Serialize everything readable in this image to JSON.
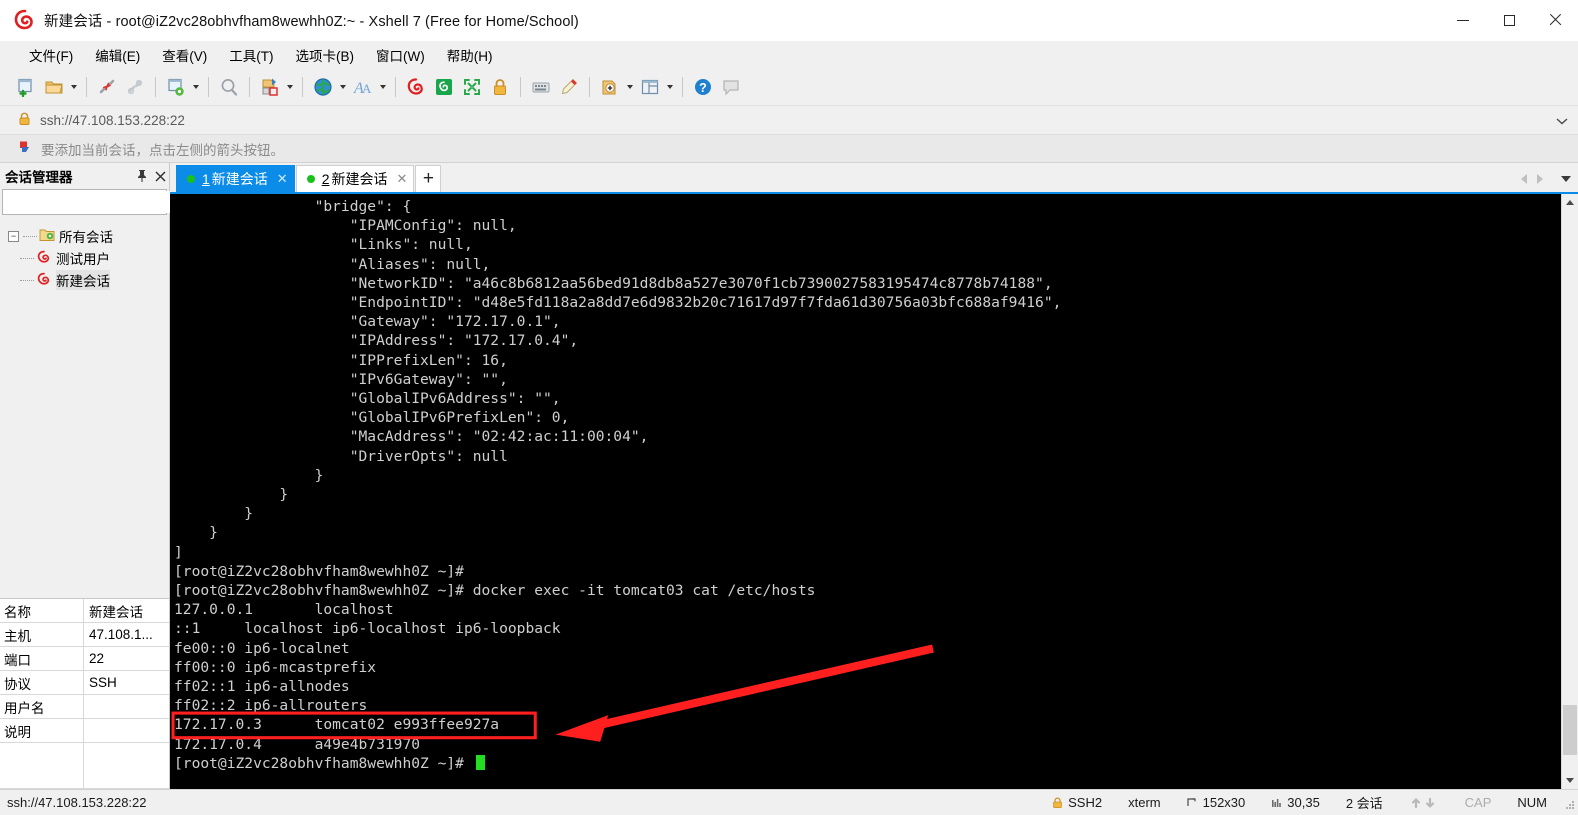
{
  "window": {
    "title": "新建会话 - root@iZ2vc28obhvfham8wewhh0Z:~ - Xshell 7 (Free for Home/School)",
    "minimize_label": "最小化",
    "maximize_label": "最大化",
    "close_label": "关闭"
  },
  "menubar": [
    {
      "label": "文件(F)",
      "name": "menu-file"
    },
    {
      "label": "编辑(E)",
      "name": "menu-edit"
    },
    {
      "label": "查看(V)",
      "name": "menu-view"
    },
    {
      "label": "工具(T)",
      "name": "menu-tools"
    },
    {
      "label": "选项卡(B)",
      "name": "menu-tab"
    },
    {
      "label": "窗口(W)",
      "name": "menu-window"
    },
    {
      "label": "帮助(H)",
      "name": "menu-help"
    }
  ],
  "toolbar": {
    "items": [
      "new-session-icon",
      "open-folder-icon",
      "disconnect-icon",
      "reconnect-icon",
      "session-properties-icon",
      "find-icon",
      "transfer-file-icon",
      "globe-icon",
      "font-icon",
      "xshell-icon",
      "xftp-icon",
      "fullscreen-icon",
      "lock-icon",
      "keyboard-icon",
      "highlight-icon",
      "compose-icon",
      "layout-icon",
      "help-icon",
      "comment-icon"
    ]
  },
  "address_bar": {
    "url": "ssh://47.108.153.228:22",
    "lock_icon": "lock-icon",
    "dropdown_icon": "chevron-down-icon"
  },
  "notice": {
    "text": "要添加当前会话，点击左侧的箭头按钮。",
    "icon": "arrow-flag-icon"
  },
  "sidebar": {
    "title": "会话管理器",
    "pin_label": "📌",
    "close_label": "✕",
    "search_placeholder": "",
    "search_value": "",
    "tree": [
      {
        "label": "所有会话",
        "level": 0,
        "icon": "folder-gear-icon",
        "selected": false
      },
      {
        "label": "测试用户",
        "level": 1,
        "icon": "session-icon",
        "selected": false
      },
      {
        "label": "新建会话",
        "level": 1,
        "icon": "session-icon",
        "selected": true
      }
    ],
    "properties": [
      {
        "key": "名称",
        "value": "新建会话"
      },
      {
        "key": "主机",
        "value": "47.108.1..."
      },
      {
        "key": "端口",
        "value": "22"
      },
      {
        "key": "协议",
        "value": "SSH"
      },
      {
        "key": "用户名",
        "value": ""
      },
      {
        "key": "说明",
        "value": ""
      }
    ]
  },
  "tabs": {
    "items": [
      {
        "num": "1",
        "label": "新建会话",
        "active": true,
        "close": "✕"
      },
      {
        "num": "2",
        "label": "新建会话",
        "active": false,
        "close": "✕"
      }
    ],
    "add_label": "+",
    "nav_prev_icon": "chevron-left-icon",
    "nav_next_icon": "chevron-right-icon",
    "nav_menu_icon": "chevron-down-icon"
  },
  "terminal": {
    "content": "                \"bridge\": {\n                    \"IPAMConfig\": null,\n                    \"Links\": null,\n                    \"Aliases\": null,\n                    \"NetworkID\": \"a46c8b6812aa56bed91d8db8a527e3070f1cb7390027583195474c8778b74188\",\n                    \"EndpointID\": \"d48e5fd118a2a8dd7e6d9832b20c71617d97f7fda61d30756a03bfc688af9416\",\n                    \"Gateway\": \"172.17.0.1\",\n                    \"IPAddress\": \"172.17.0.4\",\n                    \"IPPrefixLen\": 16,\n                    \"IPv6Gateway\": \"\",\n                    \"GlobalIPv6Address\": \"\",\n                    \"GlobalIPv6PrefixLen\": 0,\n                    \"MacAddress\": \"02:42:ac:11:00:04\",\n                    \"DriverOpts\": null\n                }\n            }\n        }\n    }\n]\n[root@iZ2vc28obhvfham8wewhh0Z ~]#\n[root@iZ2vc28obhvfham8wewhh0Z ~]# docker exec -it tomcat03 cat /etc/hosts\n127.0.0.1       localhost\n::1     localhost ip6-localhost ip6-loopback\nfe00::0 ip6-localnet\nff00::0 ip6-mcastprefix\nff02::1 ip6-allnodes\nff02::2 ip6-allrouters\n172.17.0.3      tomcat02 e993ffee927a\n172.17.0.4      a49e4b731970\n[root@iZ2vc28obhvfham8wewhh0Z ~]# ",
    "highlight_line": "172.17.0.3      tomcat02 e993ffee927a",
    "annotation_color": "#ff1f1f",
    "cursor": "block-cursor"
  },
  "statusbar": {
    "url": "ssh://47.108.153.228:22",
    "protocol": "SSH2",
    "terminal_type": "xterm",
    "size": "152x30",
    "cursor_pos": "30,35",
    "sessions": "2 会话",
    "cap": "CAP",
    "num": "NUM"
  },
  "colors": {
    "accent": "#0b8ce8",
    "terminal_bg": "#000000",
    "terminal_fg": "#cfcfcf",
    "annotation": "#ff1f1f",
    "cursor_green": "#22dd22"
  }
}
